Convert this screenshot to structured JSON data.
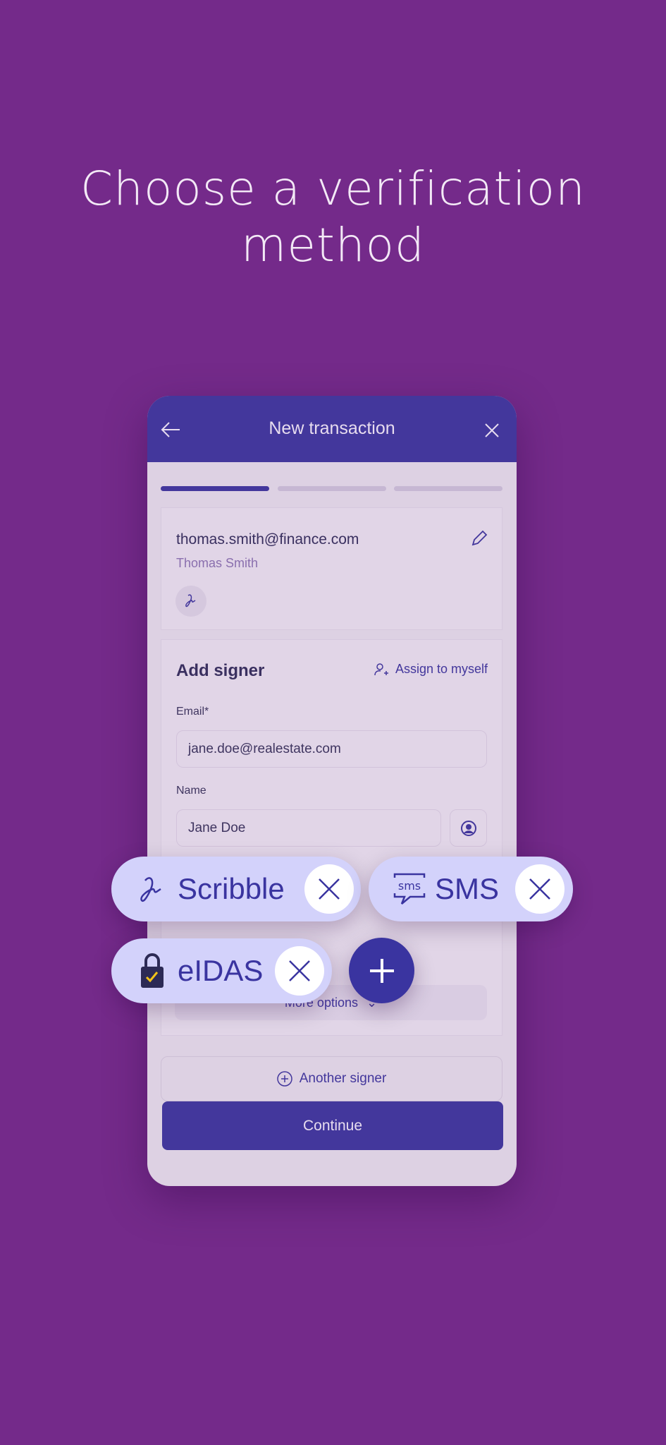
{
  "headline": "Choose a verification method",
  "colors": {
    "background": "#742a8a",
    "primary": "#43379c",
    "chip": "#d3d2fb"
  },
  "header": {
    "title": "New transaction",
    "back_icon": "arrow-left-icon",
    "close_icon": "close-icon"
  },
  "progress": {
    "current_step": 1,
    "total_steps": 3
  },
  "owner": {
    "email": "thomas.smith@finance.com",
    "name": "Thomas Smith",
    "edit_icon": "pencil-icon",
    "method_icon": "scribble-icon"
  },
  "add_signer": {
    "title": "Add signer",
    "assign_label": "Assign to myself",
    "email_label": "Email*",
    "email_value": "jane.doe@realestate.com",
    "name_label": "Name",
    "name_value": "Jane Doe",
    "more_options": "More options"
  },
  "another_signer": "Another signer",
  "continue": "Continue",
  "chips": [
    {
      "label": "Scribble",
      "icon": "scribble-icon"
    },
    {
      "label": "SMS",
      "icon": "sms-icon"
    },
    {
      "label": "eIDAS",
      "icon": "eu-lock-icon"
    }
  ]
}
